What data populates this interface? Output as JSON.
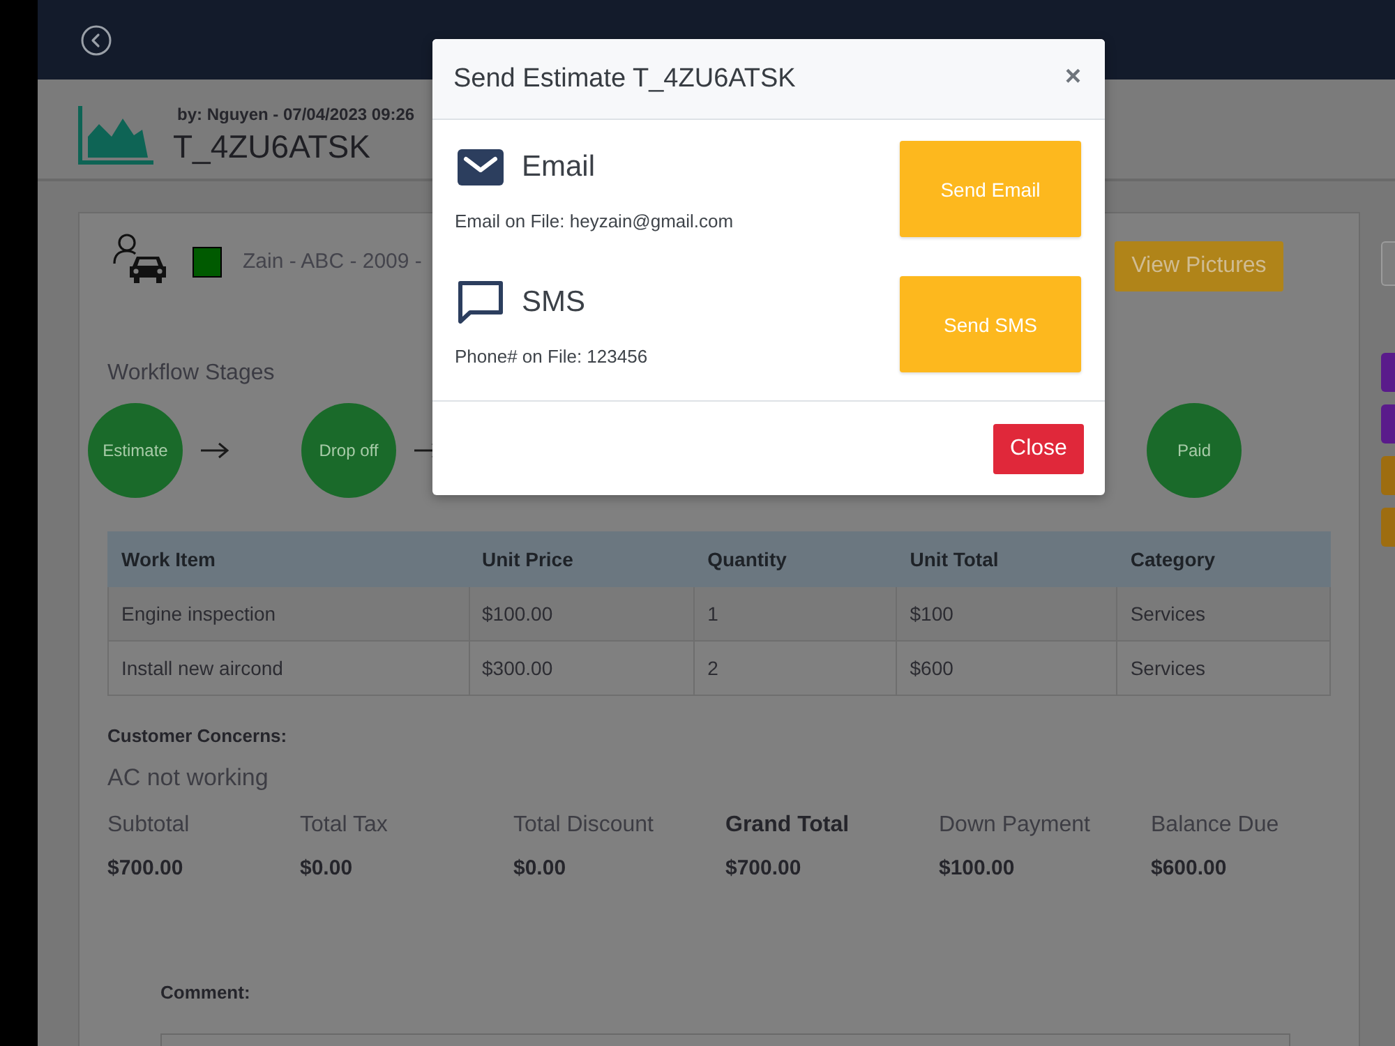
{
  "header": {
    "byline": "by: Nguyen - 07/04/2023 09:26",
    "title": "T_4ZU6ATSK"
  },
  "vehicle": {
    "color": "#005a00",
    "text": "Zain - ABC - 2009 -"
  },
  "view_pictures_button": "View Pictures",
  "side_buttons": [
    {
      "kind": "outline"
    },
    {
      "kind": "filled",
      "color": "#5a1b8b"
    },
    {
      "kind": "filled",
      "color": "#5a1b8b"
    },
    {
      "kind": "filled",
      "color": "#9e6d10"
    },
    {
      "kind": "filled",
      "color": "#9e6d10"
    }
  ],
  "workflow": {
    "title": "Workflow Stages",
    "stages": [
      {
        "label": "Estimate"
      },
      {
        "label": "Drop off"
      },
      {
        "label": "Paid"
      }
    ]
  },
  "table": {
    "columns": [
      "Work Item",
      "Unit Price",
      "Quantity",
      "Unit Total",
      "Category"
    ],
    "rows": [
      [
        "Engine inspection",
        "$100.00",
        "1",
        "$100",
        "Services"
      ],
      [
        "Install new aircond",
        "$300.00",
        "2",
        "$600",
        "Services"
      ]
    ]
  },
  "concerns": {
    "label": "Customer Concerns:",
    "text": "AC not working"
  },
  "totals": [
    {
      "label": "Subtotal",
      "value": "$700.00",
      "highlight": false
    },
    {
      "label": "Total Tax",
      "value": "$0.00",
      "highlight": false
    },
    {
      "label": "Total Discount",
      "value": "$0.00",
      "highlight": false
    },
    {
      "label": "Grand Total",
      "value": "$700.00",
      "highlight": true
    },
    {
      "label": "Down Payment",
      "value": "$100.00",
      "highlight": false
    },
    {
      "label": "Balance Due",
      "value": "$600.00",
      "highlight": false
    }
  ],
  "comment": {
    "label": "Comment:"
  },
  "modal": {
    "title": "Send Estimate T_4ZU6ATSK",
    "close": "×",
    "channels": [
      {
        "kind": "email",
        "name": "Email",
        "detail": "Email on File: heyzain@gmail.com",
        "button": "Send Email"
      },
      {
        "kind": "sms",
        "name": "SMS",
        "detail": "Phone# on File: 123456",
        "button": "Send SMS"
      }
    ],
    "footer_button": "Close"
  }
}
